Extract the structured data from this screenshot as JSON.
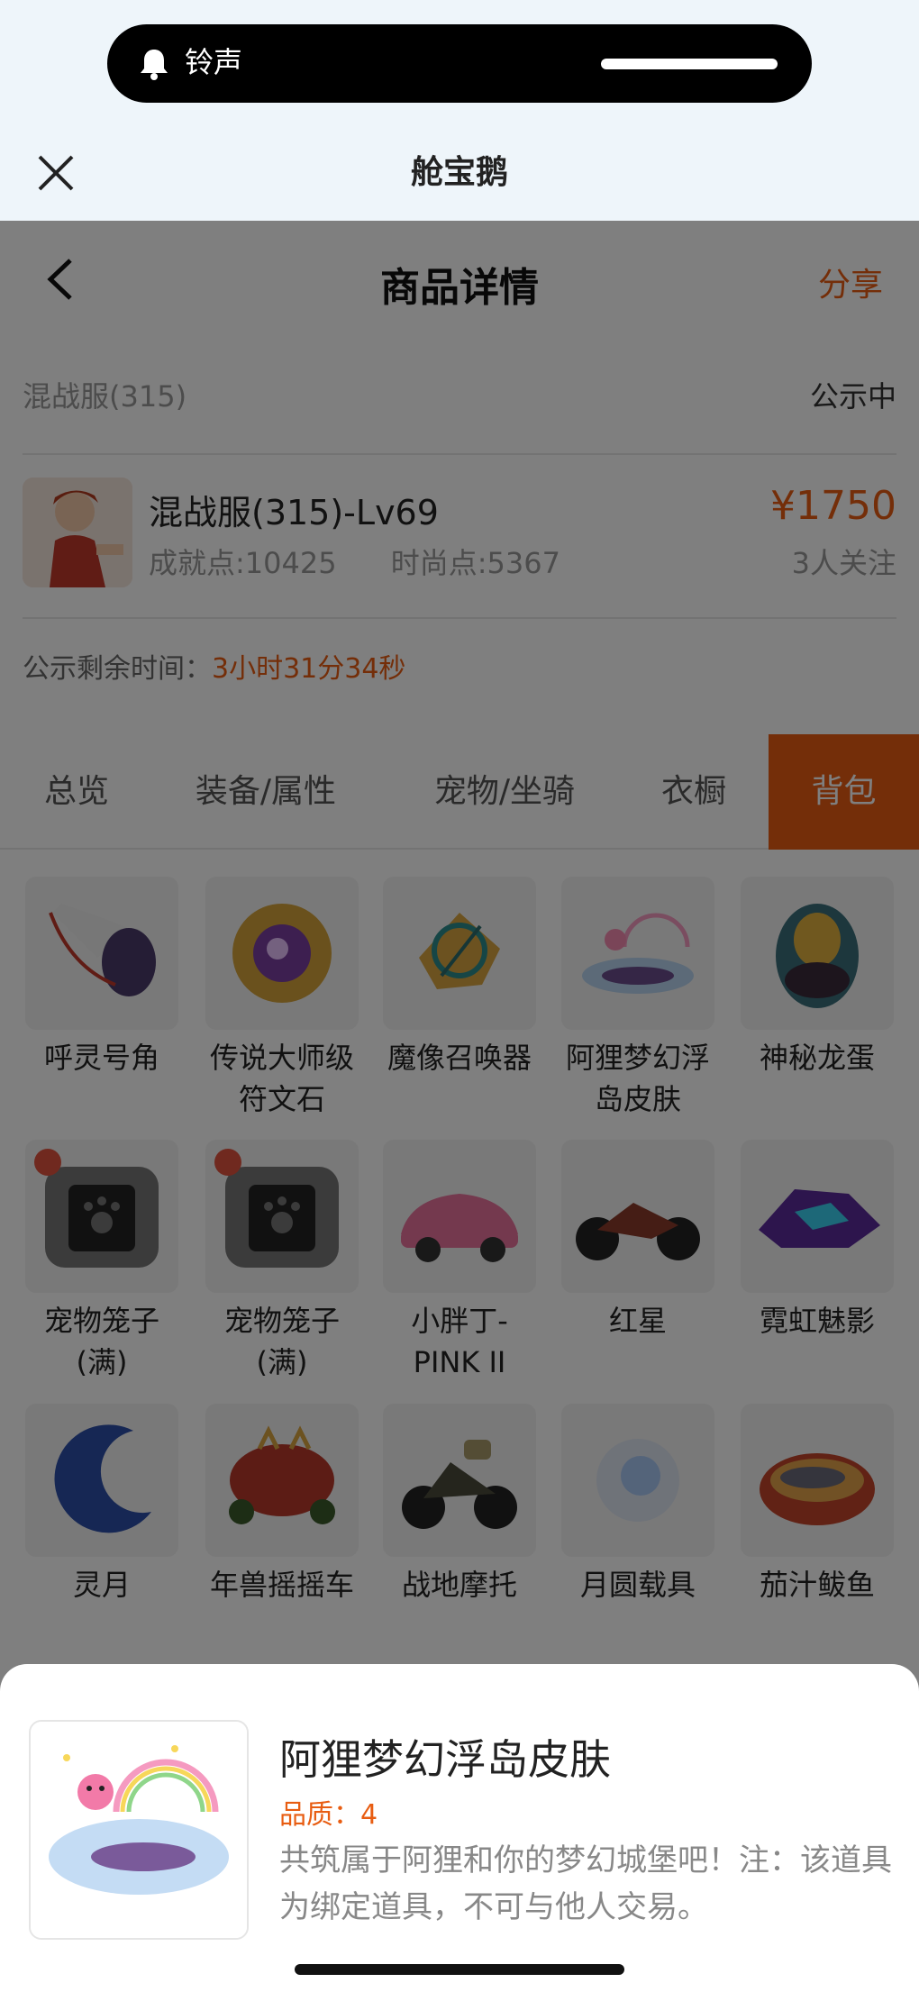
{
  "notification": {
    "label": "铃声",
    "icon": "bell-icon"
  },
  "mini_program": {
    "title": "舱宝鹅",
    "close_icon": "close-icon"
  },
  "nav": {
    "title": "商品详情",
    "share": "分享",
    "back_icon": "chevron-left-icon"
  },
  "server": {
    "name": "混战服(315)",
    "status": "公示中"
  },
  "item": {
    "name": "混战服(315)-Lv69",
    "achievement": "成就点:10425",
    "fashion": "时尚点:5367",
    "price": "¥1750",
    "followers": "3人关注"
  },
  "remaining": {
    "label": "公示剩余时间：",
    "time": "3小时31分34秒"
  },
  "tabs": [
    "总览",
    "装备/属性",
    "宠物/坐骑",
    "衣橱",
    "背包"
  ],
  "active_tab": "背包",
  "grid_items": [
    {
      "label": "呼灵号角"
    },
    {
      "label": "传说大师级符文石"
    },
    {
      "label": "魔像召唤器"
    },
    {
      "label": "阿狸梦幻浮岛皮肤"
    },
    {
      "label": "神秘龙蛋"
    },
    {
      "label": "宠物笼子(满)"
    },
    {
      "label": "宠物笼子(满)"
    },
    {
      "label": "小胖丁-PINK II"
    },
    {
      "label": "红星"
    },
    {
      "label": "霓虹魅影"
    },
    {
      "label": "灵月"
    },
    {
      "label": "年兽摇摇车"
    },
    {
      "label": "战地摩托"
    },
    {
      "label": "月圆载具"
    },
    {
      "label": "茄汁鲅鱼"
    }
  ],
  "sheet": {
    "name": "阿狸梦幻浮岛皮肤",
    "quality": "品质：4",
    "description": "共筑属于阿狸和你的梦幻城堡吧！注：该道具为绑定道具，不可与他人交易。"
  },
  "colors": {
    "accent": "#e85d12",
    "overlay": "rgba(0,0,0,0.5)"
  }
}
